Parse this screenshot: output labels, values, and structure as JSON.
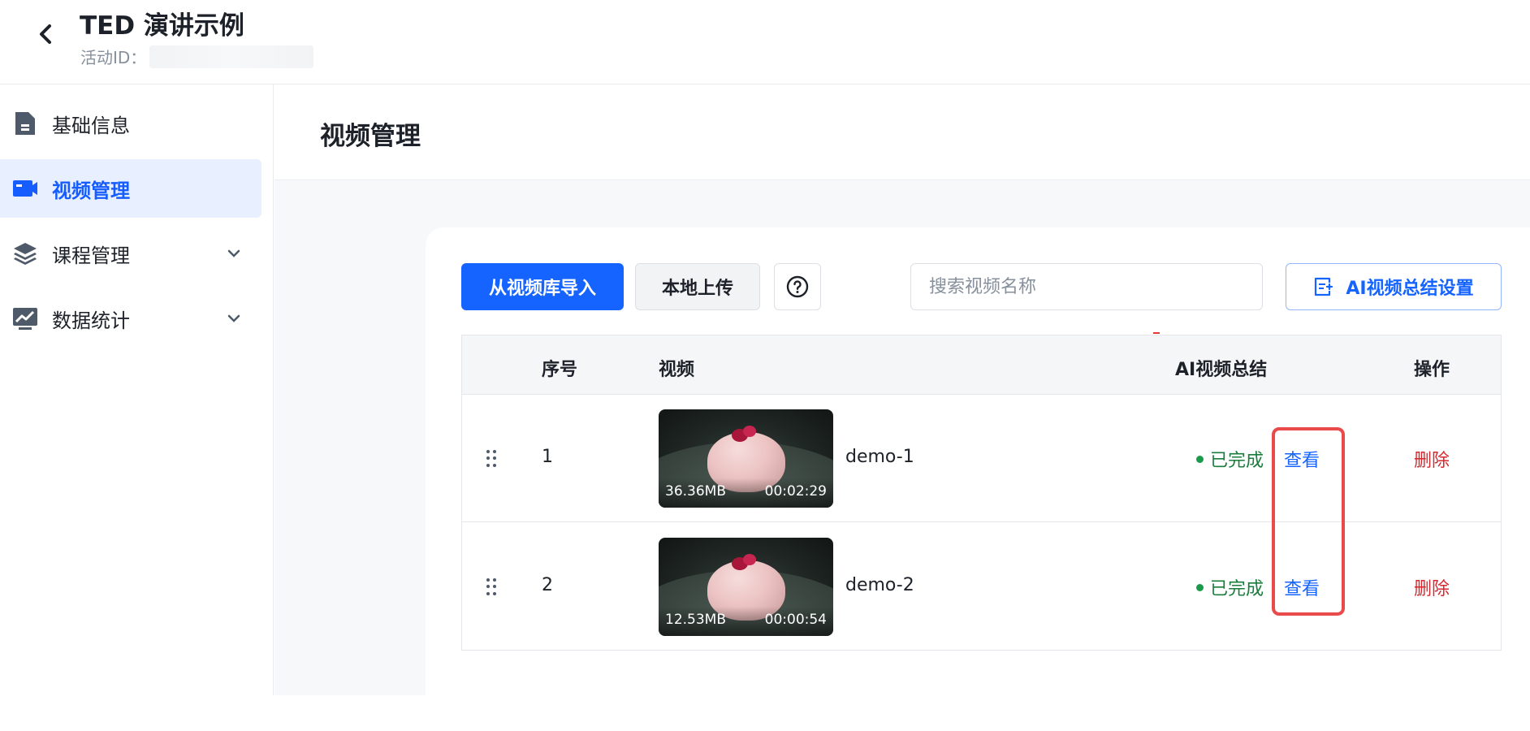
{
  "header": {
    "title": "TED 演讲示例",
    "activity_id_label": "活动ID："
  },
  "sidebar": {
    "items": [
      {
        "label": "基础信息",
        "icon": "document-icon",
        "active": false
      },
      {
        "label": "视频管理",
        "icon": "video-icon",
        "active": true
      },
      {
        "label": "课程管理",
        "icon": "layers-icon",
        "active": false,
        "expandable": true
      },
      {
        "label": "数据统计",
        "icon": "chart-icon",
        "active": false,
        "expandable": true
      }
    ]
  },
  "page": {
    "title": "视频管理"
  },
  "toolbar": {
    "import_label": "从视频库导入",
    "upload_label": "本地上传",
    "search_placeholder": "搜索视频名称",
    "ai_settings_label": "AI视频总结设置"
  },
  "table": {
    "headers": {
      "index": "序号",
      "video": "视频",
      "ai_summary": "AI视频总结",
      "actions": "操作"
    },
    "rows": [
      {
        "index": "1",
        "name": "demo-1",
        "size": "36.36MB",
        "duration": "00:02:29",
        "status": "已完成",
        "view": "查看",
        "delete": "删除"
      },
      {
        "index": "2",
        "name": "demo-2",
        "size": "12.53MB",
        "duration": "00:00:54",
        "status": "已完成",
        "view": "查看",
        "delete": "删除"
      }
    ]
  },
  "colors": {
    "primary": "#1664ff",
    "success": "#1a7d3c",
    "danger": "#d9262c",
    "highlight": "#e94b4b"
  }
}
